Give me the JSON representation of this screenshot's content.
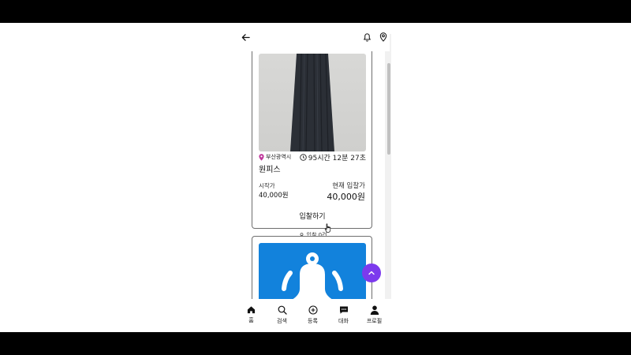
{
  "listing": {
    "location": "부산광역시",
    "time_left": "95시간 12분 27초",
    "title": "원피스",
    "start_price_label": "시작가",
    "start_price": "40,000원",
    "current_bid_label": "현재 입찰가",
    "current_bid": "40,000원",
    "bid_button": "입찰하기",
    "bid_count": "입찰 0건"
  },
  "nav": {
    "items": [
      {
        "label": "홈",
        "icon": "home-icon"
      },
      {
        "label": "검색",
        "icon": "search-icon"
      },
      {
        "label": "등록",
        "icon": "plus-circle-icon"
      },
      {
        "label": "대화",
        "icon": "chat-icon"
      },
      {
        "label": "프로필",
        "icon": "user-icon"
      }
    ]
  },
  "colors": {
    "location_pin": "#c0399c",
    "fab": "#7c3aed",
    "placeholder_blue": "#1282dc"
  }
}
